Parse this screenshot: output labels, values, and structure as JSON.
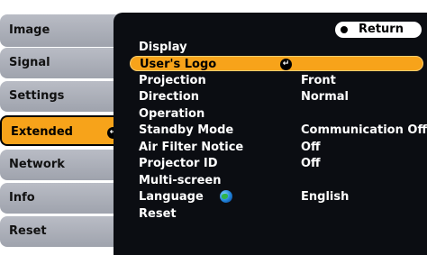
{
  "tabs": [
    {
      "label": "Image",
      "name": "tab-image",
      "active": false
    },
    {
      "label": "Signal",
      "name": "tab-signal",
      "active": false
    },
    {
      "label": "Settings",
      "name": "tab-settings",
      "active": false
    },
    {
      "label": "Extended",
      "name": "tab-extended",
      "active": true
    },
    {
      "label": "Network",
      "name": "tab-network",
      "active": false
    },
    {
      "label": "Info",
      "name": "tab-info",
      "active": false
    },
    {
      "label": "Reset",
      "name": "tab-reset",
      "active": false
    }
  ],
  "return_label": "Return",
  "items": [
    {
      "label": "Display",
      "value": ""
    },
    {
      "label": "User's Logo",
      "value": "",
      "selected": true,
      "enter": true
    },
    {
      "label": "Projection",
      "value": "Front"
    },
    {
      "label": "Direction",
      "value": "Normal"
    },
    {
      "label": "Operation",
      "value": ""
    },
    {
      "label": "Standby Mode",
      "value": "Communication Off"
    },
    {
      "label": "Air Filter Notice",
      "value": "Off"
    },
    {
      "label": "Projector ID",
      "value": "Off"
    },
    {
      "label": "Multi-screen",
      "value": ""
    },
    {
      "label": "Language",
      "value": "English",
      "globe": true
    },
    {
      "label": "Reset",
      "value": ""
    }
  ],
  "colors": {
    "accent": "#f7a31a",
    "panel": "#0b0d12",
    "tab": "#a9adb6"
  },
  "icons": {
    "enter": "enter-icon",
    "language": "globe-icon"
  }
}
